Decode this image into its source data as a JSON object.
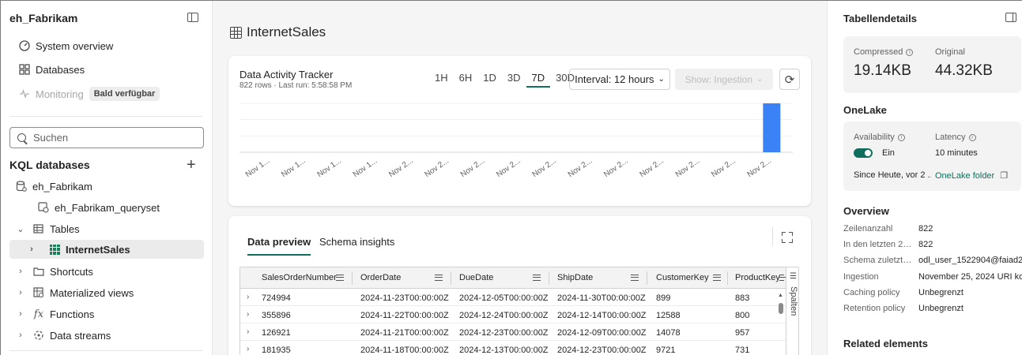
{
  "sidebar": {
    "workspace_title": "eh_Fabrikam",
    "nav": [
      {
        "label": "System overview",
        "icon": "gauge-icon"
      },
      {
        "label": "Databases",
        "icon": "grid-icon"
      },
      {
        "label": "Monitoring",
        "icon": "pulse-icon",
        "badge": "Bald verfügbar"
      }
    ],
    "search_placeholder": "Suchen",
    "kql_header": "KQL databases",
    "tree": [
      {
        "label": "eh_Fabrikam",
        "icon": "database-icon"
      },
      {
        "label": "eh_Fabrikam_queryset",
        "icon": "queryset-icon"
      },
      {
        "label": "Tables",
        "icon": "table-icon"
      },
      {
        "label": "InternetSales",
        "icon": "table-grid-icon"
      },
      {
        "label": "Shortcuts",
        "icon": "shortcut-icon"
      },
      {
        "label": "Materialized views",
        "icon": "materialized-view-icon"
      },
      {
        "label": "Functions",
        "icon": "function-icon"
      },
      {
        "label": "Data streams",
        "icon": "data-stream-icon"
      }
    ]
  },
  "main": {
    "title": "InternetSales",
    "tracker": {
      "title": "Data Activity Tracker",
      "subtitle": "822 rows · Last run: 5:58:58 PM",
      "ranges": [
        "1H",
        "6H",
        "1D",
        "3D",
        "7D",
        "30D"
      ],
      "active_range": "7D",
      "interval_label": "Interval: 12 hours",
      "show_label": "Show: Ingestion"
    },
    "tabs": [
      "Data preview",
      "Schema insights"
    ],
    "columns_label": "Spalten",
    "grid": {
      "columns": [
        "SalesOrderNumber",
        "OrderDate",
        "DueDate",
        "ShipDate",
        "CustomerKey",
        "ProductKey"
      ],
      "rows": [
        [
          "724994",
          "2024-11-23T00:00:00Z",
          "2024-12-05T00:00:00Z",
          "2024-11-30T00:00:00Z",
          "899",
          "883"
        ],
        [
          "355896",
          "2024-11-22T00:00:00Z",
          "2024-12-24T00:00:00Z",
          "2024-12-14T00:00:00Z",
          "12588",
          "800"
        ],
        [
          "126921",
          "2024-11-21T00:00:00Z",
          "2024-12-23T00:00:00Z",
          "2024-12-09T00:00:00Z",
          "14078",
          "957"
        ],
        [
          "181935",
          "2024-11-18T00:00:00Z",
          "2024-12-13T00:00:00Z",
          "2024-12-23T00:00:00Z",
          "9721",
          "731"
        ]
      ]
    }
  },
  "chart_data": {
    "type": "bar",
    "categories": [
      "Nov 1...",
      "Nov 1...",
      "Nov 1...",
      "Nov 1...",
      "Nov 2...",
      "Nov 2...",
      "Nov 2...",
      "Nov 2...",
      "Nov 2...",
      "Nov 2...",
      "Nov 2...",
      "Nov 2...",
      "Nov 2...",
      "Nov 2...",
      "Nov 2..."
    ],
    "values": [
      0,
      0,
      0,
      0,
      0,
      0,
      0,
      0,
      0,
      0,
      0,
      0,
      0,
      0,
      822
    ],
    "bar_color": "#3b82f6",
    "grid": true
  },
  "rpanel": {
    "title": "Tabellendetails",
    "compressed_label": "Compressed",
    "compressed_value": "19.14KB",
    "original_label": "Original",
    "original_value": "44.32KB",
    "onelake_title": "OneLake",
    "availability_label": "Availability",
    "availability_value": "Ein",
    "latency_label": "Latency",
    "latency_value": "10 minutes",
    "since_text": "Since Heute, vor 2 ...",
    "onelake_folder": "OneLake folder",
    "overview_title": "Overview",
    "overview": [
      {
        "k": "Zeilenanzahl",
        "v": "822"
      },
      {
        "k": "In den letzten 24 ...",
        "v": "822"
      },
      {
        "k": "Schema zuletzt g...",
        "v": "odl_user_1522904@faiad20..."
      },
      {
        "k": "Ingestion",
        "v": "November 25, 2024  URI kop"
      },
      {
        "k": "Caching policy",
        "v": "Unbegrenzt"
      },
      {
        "k": "Retention policy",
        "v": "Unbegrenzt"
      }
    ],
    "related_title": "Related elements"
  },
  "colors": {
    "accent": "#0f6f5c",
    "bar": "#3b82f6"
  }
}
